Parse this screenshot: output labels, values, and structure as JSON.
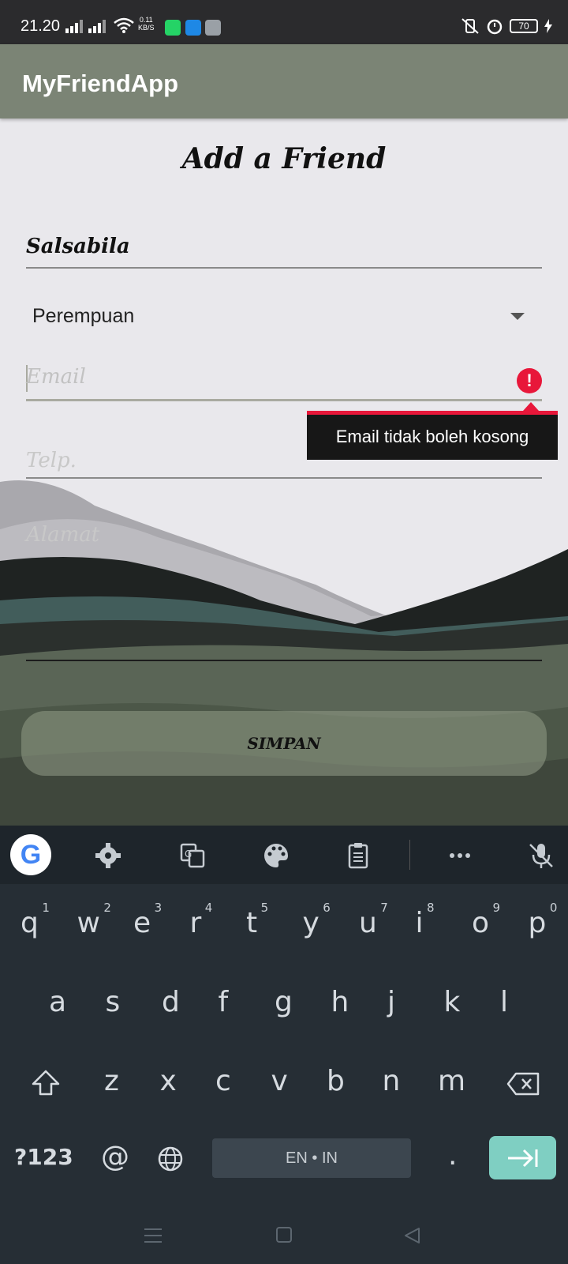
{
  "status_bar": {
    "time": "21.20",
    "net_speed_value": "0.11",
    "net_speed_unit": "KB/S",
    "battery": "70"
  },
  "app_bar": {
    "title": "MyFriendApp"
  },
  "form": {
    "title": "Add a Friend",
    "name_value": "Salsabila",
    "gender_selected": "Perempuan",
    "email_placeholder": "Email",
    "email_error": "Email tidak boleh kosong",
    "telp_placeholder": "Telp.",
    "alamat_placeholder": "Alamat",
    "save_label": "SIMPAN"
  },
  "keyboard": {
    "row1": [
      {
        "l": "q",
        "n": "1"
      },
      {
        "l": "w",
        "n": "2"
      },
      {
        "l": "e",
        "n": "3"
      },
      {
        "l": "r",
        "n": "4"
      },
      {
        "l": "t",
        "n": "5"
      },
      {
        "l": "y",
        "n": "6"
      },
      {
        "l": "u",
        "n": "7"
      },
      {
        "l": "i",
        "n": "8"
      },
      {
        "l": "o",
        "n": "9"
      },
      {
        "l": "p",
        "n": "0"
      }
    ],
    "row2": [
      "a",
      "s",
      "d",
      "f",
      "g",
      "h",
      "j",
      "k",
      "l"
    ],
    "row3": [
      "z",
      "x",
      "c",
      "v",
      "b",
      "n",
      "m"
    ],
    "symbols_label": "?123",
    "at_label": "@",
    "space_label": "EN • IN",
    "period_label": ".",
    "colors": {
      "background": "#262e35",
      "toolbar": "#1e252b",
      "enter": "#7fcfc2",
      "error": "#e8173a"
    }
  },
  "colors": {
    "app_bar": "#7b8475",
    "status_bar": "#2b2b2d"
  }
}
